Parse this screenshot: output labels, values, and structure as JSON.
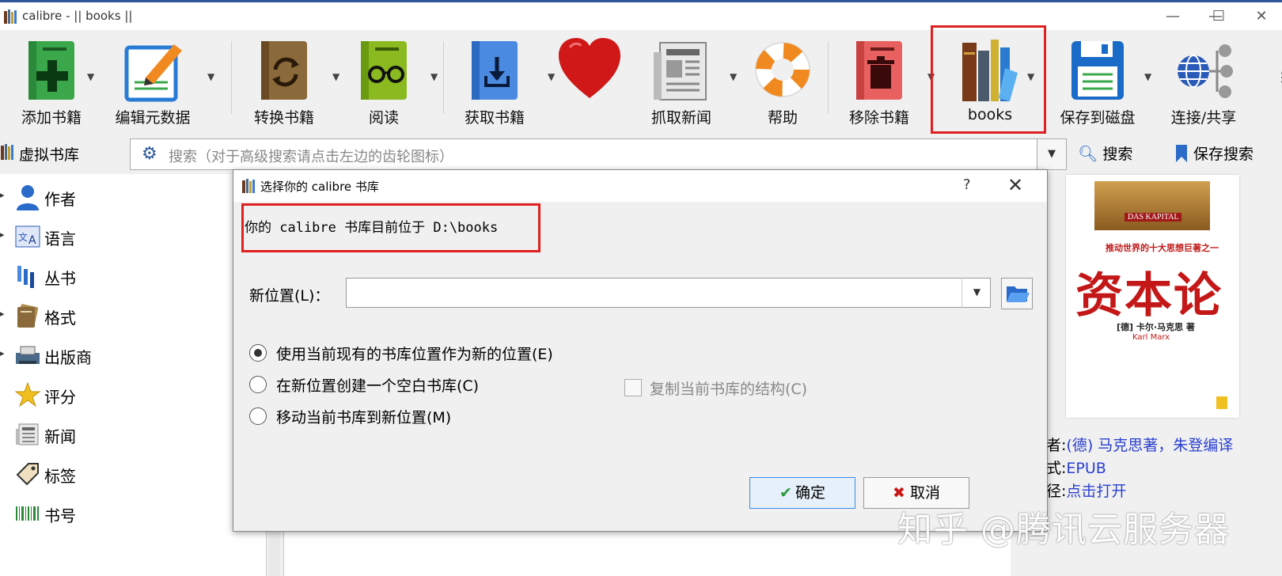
{
  "window": {
    "title": "calibre - || books ||",
    "minimize": "—",
    "maximize": "☐",
    "close": "✕"
  },
  "toolbar": {
    "items": [
      {
        "label": "添加书籍",
        "icon": "add-book-icon",
        "color": "#3aa84a"
      },
      {
        "label": "编辑元数据",
        "icon": "edit-metadata-icon",
        "color": "#2a7bd5"
      },
      {
        "label": "转换书籍",
        "icon": "convert-book-icon",
        "color": "#8a6a3a"
      },
      {
        "label": "阅读",
        "icon": "read-book-icon",
        "color": "#7aa820"
      },
      {
        "label": "获取书籍",
        "icon": "get-books-icon",
        "color": "#2a7bd5"
      },
      {
        "label": "",
        "icon": "heart-icon",
        "color": "#d81818"
      },
      {
        "label": "抓取新闻",
        "icon": "news-icon",
        "color": "#777777"
      },
      {
        "label": "帮助",
        "icon": "help-lifebuoy-icon",
        "color": "#f08a20"
      },
      {
        "label": "移除书籍",
        "icon": "remove-book-icon",
        "color": "#d84040"
      },
      {
        "label": "books",
        "icon": "library-books-icon",
        "color": "#8a3a2a"
      },
      {
        "label": "保存到磁盘",
        "icon": "save-disk-icon",
        "color": "#1a6ac8"
      },
      {
        "label": "连接/共享",
        "icon": "connect-share-icon",
        "color": "#2a5ab8"
      }
    ]
  },
  "searchbar": {
    "virtual_library": "虚拟书库",
    "placeholder": "搜索（对于高级搜索请点击左边的齿轮图标）",
    "search_button": "搜索",
    "save_search_button": "保存搜索"
  },
  "sidebar": {
    "items": [
      {
        "label": "作者",
        "icon": "person-icon"
      },
      {
        "label": "语言",
        "icon": "language-icon"
      },
      {
        "label": "丛书",
        "icon": "series-icon"
      },
      {
        "label": "格式",
        "icon": "format-icon"
      },
      {
        "label": "出版商",
        "icon": "publisher-icon"
      },
      {
        "label": "评分",
        "icon": "star-icon"
      },
      {
        "label": "新闻",
        "icon": "news-icon"
      },
      {
        "label": "标签",
        "icon": "tag-icon"
      },
      {
        "label": "书号",
        "icon": "barcode-icon"
      }
    ]
  },
  "book_details": {
    "cover_title": "资本论",
    "cover_subtitle": "DAS KAPITAL",
    "cover_tagline": "推动世界的十大思想巨著之一",
    "cover_author": "[德] 卡尔·马克思 著",
    "cover_author_en": "Karl Marx",
    "author_key": "者:",
    "author_value": "(德) 马克思著，朱登编译",
    "format_key": "式:",
    "format_value": "EPUB",
    "path_key": "径:",
    "path_value": "点击打开"
  },
  "watermark": "知乎 @腾讯云服务器",
  "dialog": {
    "title": "选择你的 calibre 书库",
    "help": "?",
    "close": "✕",
    "current_location": "你的 calibre 书库目前位于 D:\\books",
    "new_location_label": "新位置(L)：",
    "new_location_value": "",
    "options": [
      {
        "label": "使用当前现有的书库位置作为新的位置(E)",
        "checked": true
      },
      {
        "label": "在新位置创建一个空白书库(C)",
        "checked": false
      },
      {
        "label": "移动当前书库到新位置(M)",
        "checked": false
      }
    ],
    "copy_structure_label": "复制当前书库的结构(C)",
    "ok_label": "确定",
    "cancel_label": "取消"
  }
}
